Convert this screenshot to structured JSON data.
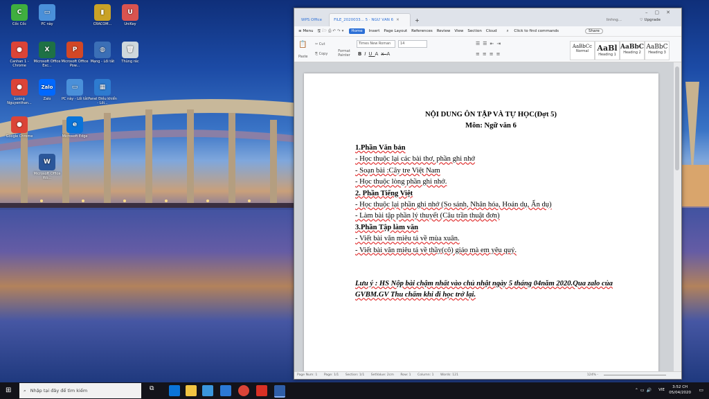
{
  "desktop_icons": [
    {
      "label": "Cốc Cốc",
      "color": "#3fae3f",
      "glyph": "C"
    },
    {
      "label": "PC này",
      "color": "#4a90d9",
      "glyph": "▭"
    },
    {
      "label": "CRACOM...",
      "color": "#c9a227",
      "glyph": "▮"
    },
    {
      "label": "UniKey",
      "color": "#d9534f",
      "glyph": "U"
    },
    {
      "label": "Canhan 1 - Chrome",
      "color": "#db4437",
      "glyph": "●"
    },
    {
      "label": "Microsoft Office Exc...",
      "color": "#1e7145",
      "glyph": "X"
    },
    {
      "label": "Microsoft Office Pow...",
      "color": "#d24726",
      "glyph": "P"
    },
    {
      "label": "Mạng - Lối tắt",
      "color": "#3b6fb6",
      "glyph": "◍"
    },
    {
      "label": "Thùng rác",
      "color": "#cfd8dc",
      "glyph": "🗑"
    },
    {
      "label": "Luong Nguyenthan...",
      "color": "#db4437",
      "glyph": "●"
    },
    {
      "label": "Zalo",
      "color": "#0068ff",
      "glyph": "Zalo"
    },
    {
      "label": "PC này - Lối tắt",
      "color": "#4a90d9",
      "glyph": "▭"
    },
    {
      "label": "Panel Điều khiển - Lối...",
      "color": "#2e7bcf",
      "glyph": "▦"
    },
    {
      "label": "Google Chrome",
      "color": "#db4437",
      "glyph": "●"
    },
    {
      "label": "Microsoft Edge",
      "color": "#0a74d9",
      "glyph": "e"
    },
    {
      "label": "Microsoft Office Wo...",
      "color": "#2b579a",
      "glyph": "W"
    }
  ],
  "window": {
    "tabs": [
      "WPS Office",
      "FILE_2020033... 5 · NGỮ VĂN 6",
      "+"
    ],
    "user": "linhng...",
    "upgrade": "Upgrade",
    "menu": [
      "≡ Menu",
      "Home",
      "Insert",
      "Page Layout",
      "References",
      "Review",
      "View",
      "Section",
      "Cloud"
    ],
    "find": "Click to find commands",
    "share": "Share",
    "ribbon": {
      "cut": "Cut",
      "copy": "Copy",
      "paste": "Paste",
      "format_painter": "Format Painter",
      "font_name": "Times New Roman",
      "font_size": "14",
      "styles": [
        {
          "sample": "AaBbCc",
          "label": "Normal"
        },
        {
          "sample": "AaBl",
          "label": "Heading 1"
        },
        {
          "sample": "AaBbC",
          "label": "Heading 2"
        },
        {
          "sample": "AaBbC",
          "label": "Heading 3"
        }
      ]
    },
    "status": {
      "page_num": "Page Num: 1",
      "page": "Page: 1/1",
      "section": "Section: 1/1",
      "setvalue": "SetValue: 2cm",
      "row": "Row: 1",
      "column": "Column: 1",
      "words": "Words: 121",
      "zoom": "124% -"
    }
  },
  "document": {
    "title": "NỘI DUNG ÔN TẬP VÀ TỰ HỌC(Đợt 5)",
    "subject": "Môn: Ngữ văn 6",
    "lines": [
      {
        "text": "1.Phần Văn bản",
        "bold": true
      },
      {
        "text": "- Học thuộc lại các bài  thơ, phần ghi nhớ",
        "bold": false
      },
      {
        "text": "- Soạn bài :Cây tre Việt Nam",
        "bold": false
      },
      {
        "text": "- Học thuộc lòng phần ghi nhớ.",
        "bold": false
      },
      {
        "text": "2. Phần Tiếng Việt",
        "bold": true
      },
      {
        "text": "- Học thuộc lại phần ghi nhớ (So sánh, Nhân hóa, Hoán dụ, Ẩn dụ)",
        "bold": false
      },
      {
        "text": "- Làm bài tập phần lý thuyết (Câu trần thuật đơn)",
        "bold": false
      },
      {
        "text": "3.Phần Tập làm văn",
        "bold": true
      },
      {
        "text": "- Viết bài văn miêu tả về mùa xuân.",
        "bold": false
      },
      {
        "text": "- Viết bài văn miêu tả về thầy(cô) giáo mà em yêu quý.",
        "bold": false
      }
    ],
    "note": "Lưu ý : HS Nộp bài chậm nhất vào chủ nhật ngày 5 tháng 04năm 2020.Qua zalo của GVBM.GV Thu chấm khi đi học trở lại."
  },
  "taskbar": {
    "search_placeholder": "Nhập tại đây để tìm kiếm",
    "time": "3:52 CH",
    "date": "05/04/2020",
    "lang": "VIE"
  }
}
